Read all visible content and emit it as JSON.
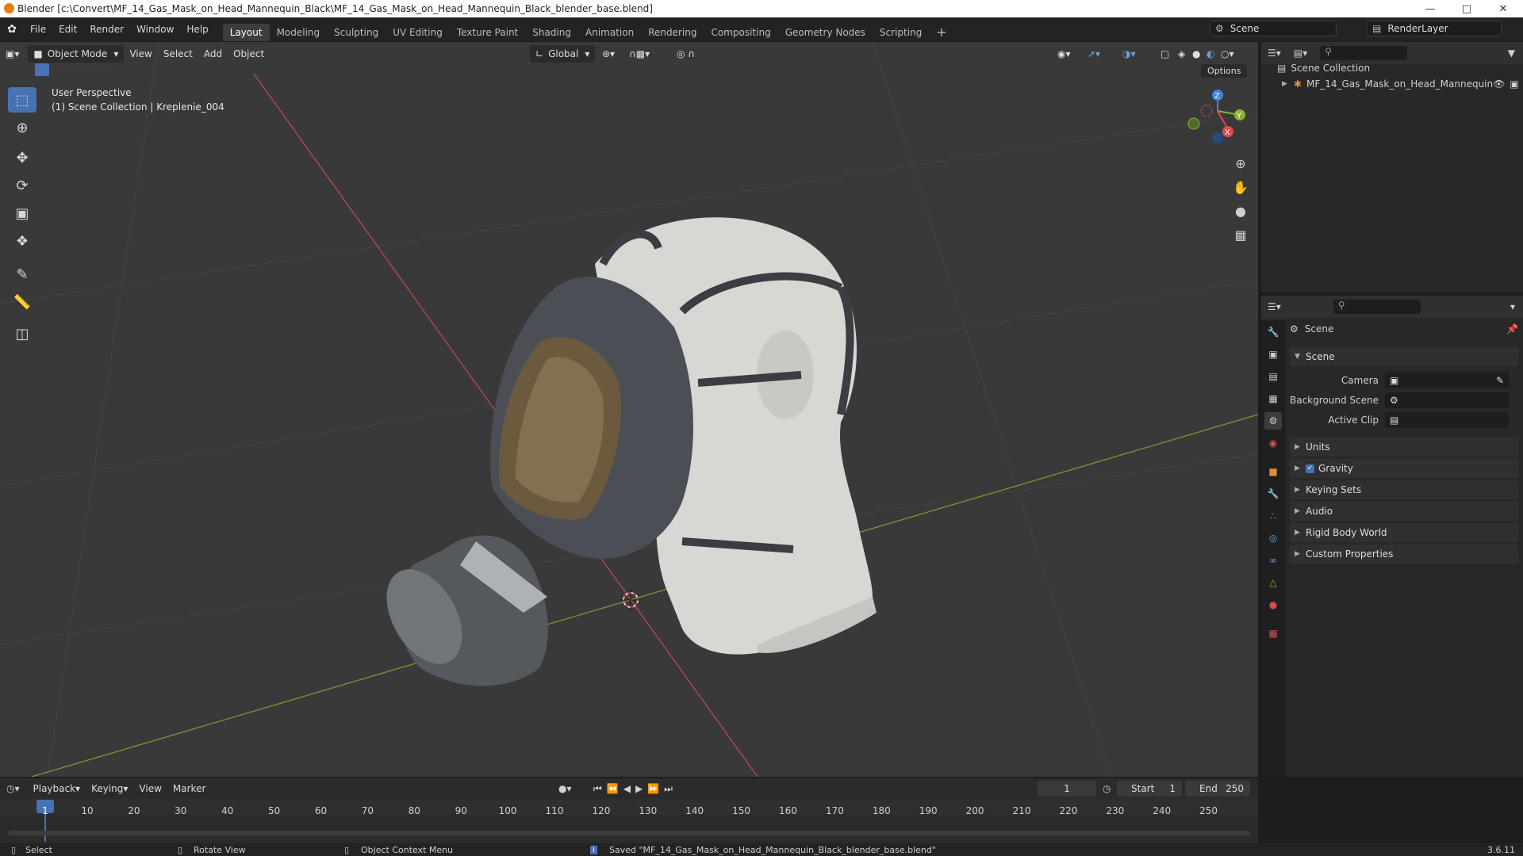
{
  "window": {
    "title": "Blender [c:\\Convert\\MF_14_Gas_Mask_on_Head_Mannequin_Black\\MF_14_Gas_Mask_on_Head_Mannequin_Black_blender_base.blend]"
  },
  "menu": [
    "File",
    "Edit",
    "Render",
    "Window",
    "Help"
  ],
  "workspaces": [
    "Layout",
    "Modeling",
    "Sculpting",
    "UV Editing",
    "Texture Paint",
    "Shading",
    "Animation",
    "Rendering",
    "Compositing",
    "Geometry Nodes",
    "Scripting"
  ],
  "scene": {
    "name": "Scene",
    "view_layer": "RenderLayer"
  },
  "viewport": {
    "mode": "Object Mode",
    "menus": [
      "View",
      "Select",
      "Add",
      "Object"
    ],
    "orientation": "Global",
    "options_label": "Options",
    "overlay_title": "User Perspective",
    "overlay_sub": "(1) Scene Collection | Kreplenie_004",
    "gizmo": {
      "x": "X",
      "y": "Y",
      "z": "Z"
    }
  },
  "outliner": {
    "root": "Scene Collection",
    "items": [
      {
        "label": "MF_14_Gas_Mask_on_Head_Mannequin"
      }
    ]
  },
  "properties": {
    "header": "Scene",
    "section": "Scene",
    "fields": [
      {
        "label": "Camera",
        "value": ""
      },
      {
        "label": "Background Scene",
        "value": ""
      },
      {
        "label": "Active Clip",
        "value": ""
      }
    ],
    "panels": [
      "Units",
      "Gravity",
      "Keying Sets",
      "Audio",
      "Rigid Body World",
      "Custom Properties"
    ],
    "gravity_enabled": true
  },
  "timeline": {
    "menus": [
      "Playback",
      "Keying",
      "View",
      "Marker"
    ],
    "current_frame": "1",
    "start_label": "Start",
    "start": "1",
    "end_label": "End",
    "end": "250",
    "ticks": [
      "1",
      "10",
      "20",
      "30",
      "40",
      "50",
      "60",
      "70",
      "80",
      "90",
      "100",
      "110",
      "120",
      "130",
      "140",
      "150",
      "160",
      "170",
      "180",
      "190",
      "200",
      "210",
      "220",
      "230",
      "240",
      "250"
    ]
  },
  "status": {
    "select": "Select",
    "rotate": "Rotate View",
    "context": "Object Context Menu",
    "message": "Saved \"MF_14_Gas_Mask_on_Head_Mannequin_Black_blender_base.blend\"",
    "version": "3.6.11"
  },
  "colors": {
    "accent": "#4772b3",
    "x_axis": "#e6484e",
    "y_axis": "#8bb334",
    "z_axis": "#3e82e0"
  }
}
